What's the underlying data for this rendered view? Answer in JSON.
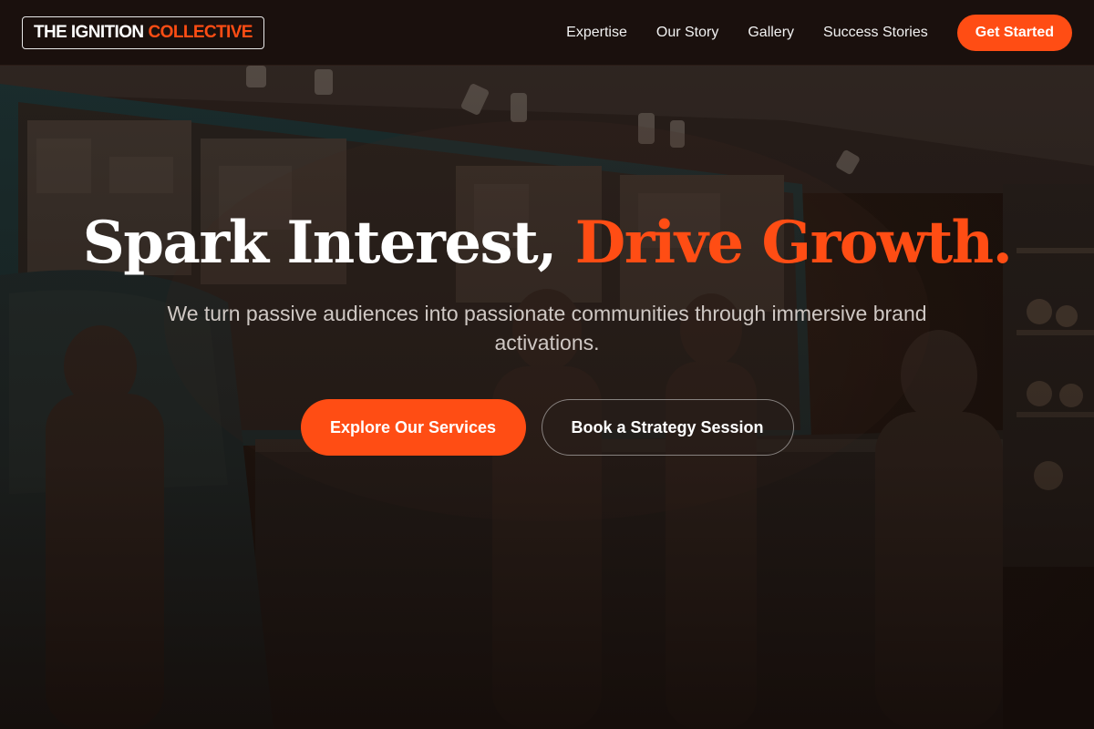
{
  "header": {
    "logo_part1": "THE IGNITION",
    "logo_part2": "COLLECTIVE",
    "nav": [
      {
        "label": "Expertise"
      },
      {
        "label": "Our Story"
      },
      {
        "label": "Gallery"
      },
      {
        "label": "Success Stories"
      }
    ],
    "cta_label": "Get Started"
  },
  "hero": {
    "headline_white": "Spark Interest,",
    "headline_accent": "Drive Growth.",
    "subtitle": "We turn passive audiences into passionate communities through immersive brand activations.",
    "primary_button": "Explore Our Services",
    "secondary_button": "Book a Strategy Session"
  },
  "colors": {
    "accent": "#ff4d14",
    "header_bg": "#1a100d",
    "hero_bg": "#24170f"
  }
}
